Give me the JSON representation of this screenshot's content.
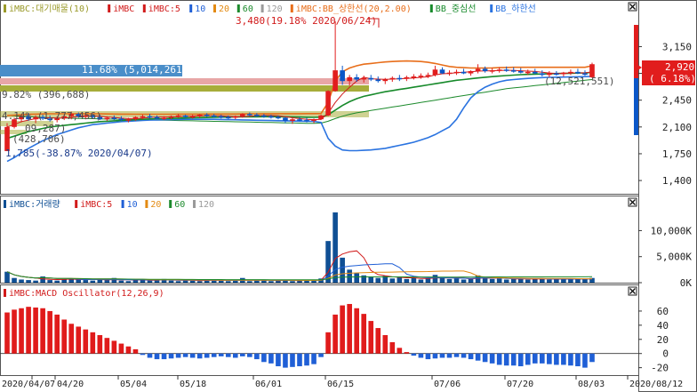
{
  "colors": {
    "up": "#e11d1d",
    "down": "#0b57c8",
    "ma5": "#d11a1a",
    "ma10": "#1f5fd6",
    "ma20": "#e38a12",
    "ma60": "#1c8a2c",
    "ma120": "#9a9a9a",
    "bb_upper": "#e86e1a",
    "bb_mid": "#178a2b",
    "bb_lower": "#2a73e0",
    "macd": "#e01b1b",
    "volume": "#0f4f94"
  },
  "price_panel": {
    "legend": [
      "iMBC:대기매물(10)",
      "iMBC",
      "iMBC:5",
      "10",
      "20",
      "60",
      "120",
      "iMBC:BB_상한선(20,2.00)",
      "BB_중심선",
      "BB_하한선"
    ],
    "legend_colors": [
      "#9a9a2a",
      "#d11a1a",
      "#d11a1a",
      "#1f5fd6",
      "#e38a12",
      "#1c8a2c",
      "#9a9a9a",
      "#e86e1a",
      "#178a2b",
      "#2a73e0"
    ],
    "y_ticks": [
      "3,150",
      "2,800",
      "2,450",
      "2,100",
      "1,750",
      "1,400"
    ],
    "current_price": "2,920",
    "current_change": "( 6.18%)",
    "annotation_high": "3,480(19.18% 2020/06/24)",
    "annotation_low": "1,785(-38.87% 2020/04/07)",
    "supply_labels": [
      "11.68% (5,014,261)",
      "9.82% (396,688)",
      "4.14% (1,777,456)",
      "(12,521,551)",
      "09,287)",
      "(428,706)"
    ]
  },
  "volume_panel": {
    "legend": [
      "iMBC:거래량",
      "iMBC:5",
      "10",
      "20",
      "60",
      "120"
    ],
    "legend_colors": [
      "#0f4f94",
      "#d11a1a",
      "#1f5fd6",
      "#e38a12",
      "#1c8a2c",
      "#9a9a9a"
    ],
    "y_ticks": [
      "10,000K",
      "5,000K",
      "0K"
    ]
  },
  "macd_panel": {
    "legend": [
      "iMBC:MACD Oscillator(12,26,9)"
    ],
    "legend_colors": [
      "#d11a1a"
    ],
    "y_ticks": [
      "60",
      "40",
      "20",
      "0",
      "-20"
    ]
  },
  "x_axis": {
    "labels": [
      "2020/04/07",
      "04/20",
      "05/04",
      "05/18",
      "06/01",
      "06/15",
      "07/06",
      "07/20",
      "08/03",
      "2020/08/12"
    ]
  },
  "chart_data": {
    "type": "candlestick",
    "dates_start": "2020/04/07",
    "dates_end": "2020/08/12",
    "ohlc": [
      [
        1785,
        2150,
        1785,
        2100
      ],
      [
        2100,
        2220,
        2080,
        2200
      ],
      [
        2200,
        2260,
        2160,
        2240
      ],
      [
        2240,
        2280,
        2180,
        2200
      ],
      [
        2200,
        2250,
        2150,
        2230
      ],
      [
        2230,
        2260,
        2190,
        2210
      ],
      [
        2210,
        2250,
        2170,
        2190
      ],
      [
        2190,
        2240,
        2160,
        2220
      ],
      [
        2220,
        2260,
        2190,
        2240
      ],
      [
        2240,
        2300,
        2200,
        2270
      ],
      [
        2270,
        2290,
        2220,
        2240
      ],
      [
        2240,
        2270,
        2200,
        2250
      ],
      [
        2250,
        2270,
        2210,
        2230
      ],
      [
        2230,
        2260,
        2190,
        2200
      ],
      [
        2200,
        2240,
        2180,
        2220
      ],
      [
        2220,
        2250,
        2190,
        2210
      ],
      [
        2210,
        2240,
        2180,
        2190
      ],
      [
        2190,
        2220,
        2160,
        2200
      ],
      [
        2200,
        2240,
        2180,
        2230
      ],
      [
        2230,
        2260,
        2200,
        2240
      ],
      [
        2240,
        2270,
        2210,
        2230
      ],
      [
        2230,
        2250,
        2200,
        2210
      ],
      [
        2210,
        2240,
        2190,
        2220
      ],
      [
        2220,
        2250,
        2200,
        2240
      ],
      [
        2240,
        2270,
        2220,
        2250
      ],
      [
        2250,
        2260,
        2220,
        2230
      ],
      [
        2230,
        2260,
        2210,
        2240
      ],
      [
        2240,
        2270,
        2220,
        2260
      ],
      [
        2260,
        2280,
        2230,
        2250
      ],
      [
        2250,
        2270,
        2220,
        2240
      ],
      [
        2240,
        2260,
        2210,
        2230
      ],
      [
        2230,
        2250,
        2200,
        2220
      ],
      [
        2220,
        2250,
        2200,
        2240
      ],
      [
        2240,
        2280,
        2220,
        2270
      ],
      [
        2270,
        2290,
        2240,
        2260
      ],
      [
        2260,
        2280,
        2230,
        2250
      ],
      [
        2250,
        2270,
        2220,
        2240
      ],
      [
        2240,
        2260,
        2210,
        2230
      ],
      [
        2230,
        2250,
        2200,
        2220
      ],
      [
        2220,
        2230,
        2150,
        2180
      ],
      [
        2180,
        2220,
        2140,
        2200
      ],
      [
        2200,
        2230,
        2170,
        2190
      ],
      [
        2190,
        2220,
        2160,
        2180
      ],
      [
        2180,
        2210,
        2150,
        2200
      ],
      [
        2200,
        2260,
        2190,
        2250
      ],
      [
        2250,
        2580,
        2240,
        2570
      ],
      [
        2570,
        3480,
        2560,
        2840
      ],
      [
        2840,
        2900,
        2650,
        2700
      ],
      [
        2700,
        2780,
        2640,
        2750
      ],
      [
        2750,
        2790,
        2690,
        2720
      ],
      [
        2720,
        2770,
        2680,
        2740
      ],
      [
        2740,
        2780,
        2700,
        2720
      ],
      [
        2720,
        2760,
        2680,
        2700
      ],
      [
        2700,
        2740,
        2660,
        2720
      ],
      [
        2720,
        2760,
        2690,
        2740
      ],
      [
        2740,
        2780,
        2700,
        2730
      ],
      [
        2730,
        2770,
        2700,
        2750
      ],
      [
        2750,
        2790,
        2720,
        2760
      ],
      [
        2760,
        2800,
        2730,
        2770
      ],
      [
        2770,
        2810,
        2740,
        2780
      ],
      [
        2780,
        2900,
        2760,
        2850
      ],
      [
        2850,
        2880,
        2790,
        2800
      ],
      [
        2800,
        2840,
        2770,
        2810
      ],
      [
        2810,
        2850,
        2780,
        2820
      ],
      [
        2820,
        2860,
        2790,
        2800
      ],
      [
        2800,
        2840,
        2770,
        2830
      ],
      [
        2830,
        2920,
        2800,
        2860
      ],
      [
        2860,
        2890,
        2810,
        2830
      ],
      [
        2830,
        2870,
        2800,
        2840
      ],
      [
        2840,
        2880,
        2810,
        2850
      ],
      [
        2850,
        2890,
        2820,
        2840
      ],
      [
        2840,
        2880,
        2810,
        2830
      ],
      [
        2830,
        2870,
        2800,
        2810
      ],
      [
        2810,
        2850,
        2780,
        2820
      ],
      [
        2820,
        2860,
        2790,
        2800
      ],
      [
        2800,
        2840,
        2760,
        2780
      ],
      [
        2780,
        2830,
        2750,
        2800
      ],
      [
        2800,
        2830,
        2770,
        2790
      ],
      [
        2790,
        2820,
        2760,
        2810
      ],
      [
        2810,
        2850,
        2780,
        2820
      ],
      [
        2820,
        2860,
        2790,
        2800
      ],
      [
        2800,
        2840,
        2770,
        2790
      ],
      [
        2750,
        2940,
        2740,
        2920
      ]
    ],
    "volume_k": [
      2100,
      900,
      600,
      500,
      400,
      1200,
      500,
      400,
      600,
      800,
      700,
      500,
      400,
      600,
      500,
      900,
      400,
      300,
      500,
      600,
      400,
      500,
      700,
      400,
      300,
      500,
      400,
      300,
      600,
      400,
      500,
      300,
      400,
      900,
      300,
      400,
      500,
      300,
      400,
      600,
      300,
      400,
      500,
      400,
      800,
      8000,
      13500,
      4800,
      2500,
      1800,
      1400,
      1200,
      900,
      1300,
      800,
      1000,
      700,
      900,
      600,
      800,
      1500,
      900,
      700,
      800,
      600,
      700,
      1400,
      900,
      700,
      800,
      600,
      700,
      900,
      600,
      700,
      800,
      600,
      700,
      600,
      800,
      700,
      600,
      900
    ],
    "macd_osc": [
      58,
      62,
      64,
      66,
      65,
      64,
      60,
      55,
      48,
      42,
      38,
      34,
      30,
      26,
      22,
      18,
      14,
      10,
      6,
      -2,
      -6,
      -8,
      -8,
      -7,
      -6,
      -5,
      -6,
      -7,
      -6,
      -5,
      -4,
      -5,
      -6,
      -4,
      -5,
      -8,
      -12,
      -14,
      -18,
      -20,
      -19,
      -18,
      -17,
      -15,
      -5,
      30,
      55,
      68,
      70,
      64,
      56,
      46,
      36,
      26,
      16,
      8,
      2,
      -3,
      -6,
      -8,
      -7,
      -6,
      -6,
      -5,
      -6,
      -8,
      -10,
      -12,
      -14,
      -16,
      -17,
      -17,
      -18,
      -16,
      -14,
      -14,
      -15,
      -16,
      -16,
      -17,
      -18,
      -20,
      -12
    ],
    "ma": {
      "ma5": [
        2100,
        2130,
        2170,
        2190,
        2210,
        2220,
        2220,
        2215,
        2215,
        2225,
        2240,
        2245,
        2245,
        2240,
        2230,
        2225,
        2215,
        2210,
        2210,
        2215,
        2225,
        2230,
        2230,
        2230,
        2235,
        2240,
        2240,
        2245,
        2245,
        2245,
        2245,
        2240,
        2235,
        2235,
        2240,
        2245,
        2250,
        2250,
        2245,
        2235,
        2220,
        2210,
        2200,
        2195,
        2200,
        2280,
        2420,
        2530,
        2620,
        2700,
        2750,
        2730,
        2725,
        2722,
        2725,
        2730,
        2735,
        2740,
        2748,
        2755,
        2780,
        2795,
        2800,
        2810,
        2815,
        2820,
        2830,
        2832,
        2835,
        2838,
        2840,
        2840,
        2835,
        2830,
        2825,
        2815,
        2805,
        2800,
        2800,
        2805,
        2808,
        2806,
        2820
      ],
      "bb_upper": [
        2250,
        2255,
        2260,
        2265,
        2268,
        2270,
        2272,
        2272,
        2272,
        2272,
        2273,
        2273,
        2272,
        2271,
        2270,
        2269,
        2268,
        2267,
        2266,
        2266,
        2266,
        2266,
        2266,
        2266,
        2267,
        2267,
        2268,
        2268,
        2269,
        2269,
        2269,
        2269,
        2269,
        2270,
        2271,
        2272,
        2273,
        2273,
        2273,
        2273,
        2273,
        2273,
        2274,
        2275,
        2276,
        2420,
        2700,
        2820,
        2870,
        2900,
        2920,
        2930,
        2940,
        2950,
        2955,
        2960,
        2962,
        2960,
        2955,
        2945,
        2930,
        2910,
        2890,
        2880,
        2875,
        2870,
        2870,
        2870,
        2872,
        2875,
        2878,
        2880,
        2880,
        2880,
        2880,
        2880,
        2880,
        2880,
        2880,
        2880,
        2880,
        2880,
        2900
      ],
      "bb_mid": [
        1950,
        1980,
        2010,
        2040,
        2060,
        2080,
        2100,
        2110,
        2120,
        2130,
        2140,
        2150,
        2160,
        2170,
        2175,
        2180,
        2185,
        2190,
        2195,
        2200,
        2205,
        2208,
        2210,
        2212,
        2215,
        2218,
        2220,
        2222,
        2224,
        2226,
        2228,
        2229,
        2230,
        2231,
        2232,
        2233,
        2234,
        2234,
        2234,
        2233,
        2231,
        2229,
        2227,
        2226,
        2228,
        2260,
        2320,
        2380,
        2430,
        2470,
        2500,
        2520,
        2540,
        2560,
        2575,
        2590,
        2605,
        2620,
        2635,
        2650,
        2665,
        2680,
        2695,
        2710,
        2720,
        2730,
        2740,
        2750,
        2758,
        2765,
        2772,
        2778,
        2783,
        2787,
        2790,
        2793,
        2796,
        2798,
        2800,
        2802,
        2804,
        2806,
        2812
      ],
      "bb_lower": [
        1650,
        1700,
        1760,
        1820,
        1870,
        1920,
        1960,
        2000,
        2030,
        2060,
        2090,
        2110,
        2130,
        2140,
        2150,
        2160,
        2170,
        2175,
        2180,
        2185,
        2190,
        2192,
        2194,
        2196,
        2198,
        2200,
        2200,
        2200,
        2200,
        2200,
        2198,
        2196,
        2194,
        2192,
        2190,
        2188,
        2186,
        2184,
        2182,
        2180,
        2178,
        2176,
        2175,
        2174,
        2160,
        1950,
        1850,
        1800,
        1790,
        1790,
        1795,
        1800,
        1810,
        1820,
        1840,
        1860,
        1880,
        1900,
        1930,
        1960,
        2000,
        2050,
        2100,
        2200,
        2350,
        2480,
        2560,
        2620,
        2660,
        2690,
        2710,
        2720,
        2728,
        2735,
        2740,
        2745,
        2748,
        2750,
        2752,
        2754,
        2756,
        2758,
        2760
      ],
      "ma60": [
        2250,
        2245,
        2240,
        2235,
        2230,
        2225,
        2220,
        2218,
        2216,
        2214,
        2212,
        2210,
        2208,
        2206,
        2204,
        2202,
        2200,
        2198,
        2196,
        2194,
        2192,
        2190,
        2188,
        2186,
        2184,
        2182,
        2180,
        2178,
        2176,
        2174,
        2172,
        2170,
        2168,
        2166,
        2164,
        2162,
        2160,
        2158,
        2156,
        2154,
        2152,
        2150,
        2148,
        2148,
        2150,
        2175,
        2210,
        2240,
        2265,
        2285,
        2300,
        2315,
        2330,
        2345,
        2360,
        2375,
        2390,
        2405,
        2420,
        2435,
        2450,
        2465,
        2480,
        2495,
        2510,
        2525,
        2540,
        2555,
        2570,
        2585,
        2600,
        2610,
        2620,
        2630,
        2640,
        2650,
        2660,
        2670,
        2680,
        2690,
        2700,
        2710,
        2720
      ]
    }
  }
}
